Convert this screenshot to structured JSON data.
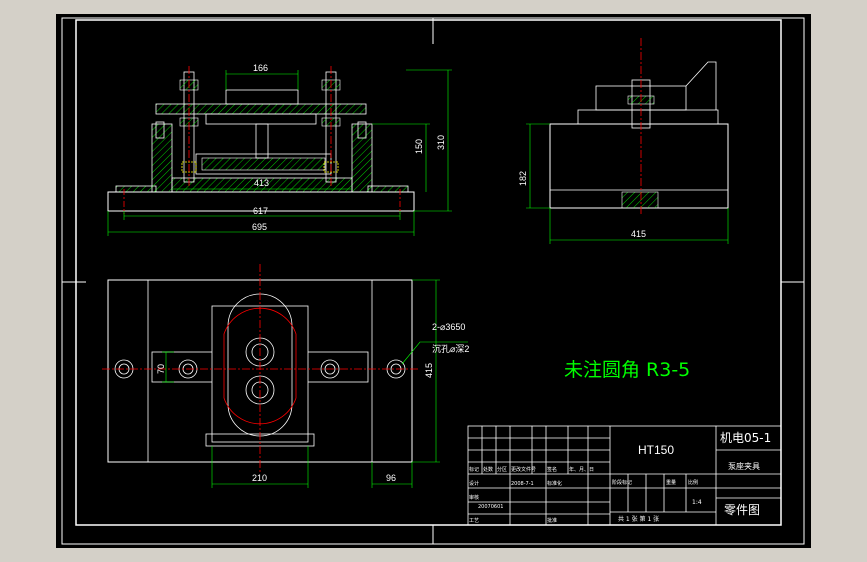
{
  "colors": {
    "frame": "#ffffff",
    "outline": "#ffffff",
    "dimension": "#00ff00",
    "centerline": "#ff0000",
    "hatch": "#00ff00",
    "hidden": "#ffff00",
    "note": "#00ff00",
    "app_background": "#d4d0c8",
    "canvas": "#000000"
  },
  "front_view": {
    "dims": {
      "top_width": "166",
      "inner_height": "150",
      "total_height": "310",
      "inner_width": "413",
      "hole_span": "617",
      "overall_width": "695"
    }
  },
  "side_view": {
    "dims": {
      "height": "182",
      "width": "415"
    }
  },
  "plan_view": {
    "dims": {
      "slot_width": "70",
      "hole_callout_1": "2-⌀3650",
      "hole_callout_2": "沉孔⌀深2",
      "height": "415",
      "bore_span": "210",
      "edge_offset": "96"
    }
  },
  "note": "未注圆角 R3-5",
  "title_block": {
    "material": "HT150",
    "drawing_code": "机电05-1",
    "part_name": "泵座夹具",
    "drawing_type": "零件图",
    "scale": "1:4",
    "sheet_info": "共 1 张  第 1 张",
    "student_id": "20070601",
    "header_cells": {
      "c1": "标记",
      "c2": "处数",
      "c3": "分区",
      "c4": "更改文件号",
      "c5": "签名",
      "c6": "年、月、日",
      "stage": "阶段标记",
      "weight": "重量",
      "ratio": "比例",
      "designer": "设计",
      "std": "标准化",
      "review": "审核",
      "craft": "工艺",
      "approve": "批准",
      "date_ref": "2008-7-1"
    }
  }
}
